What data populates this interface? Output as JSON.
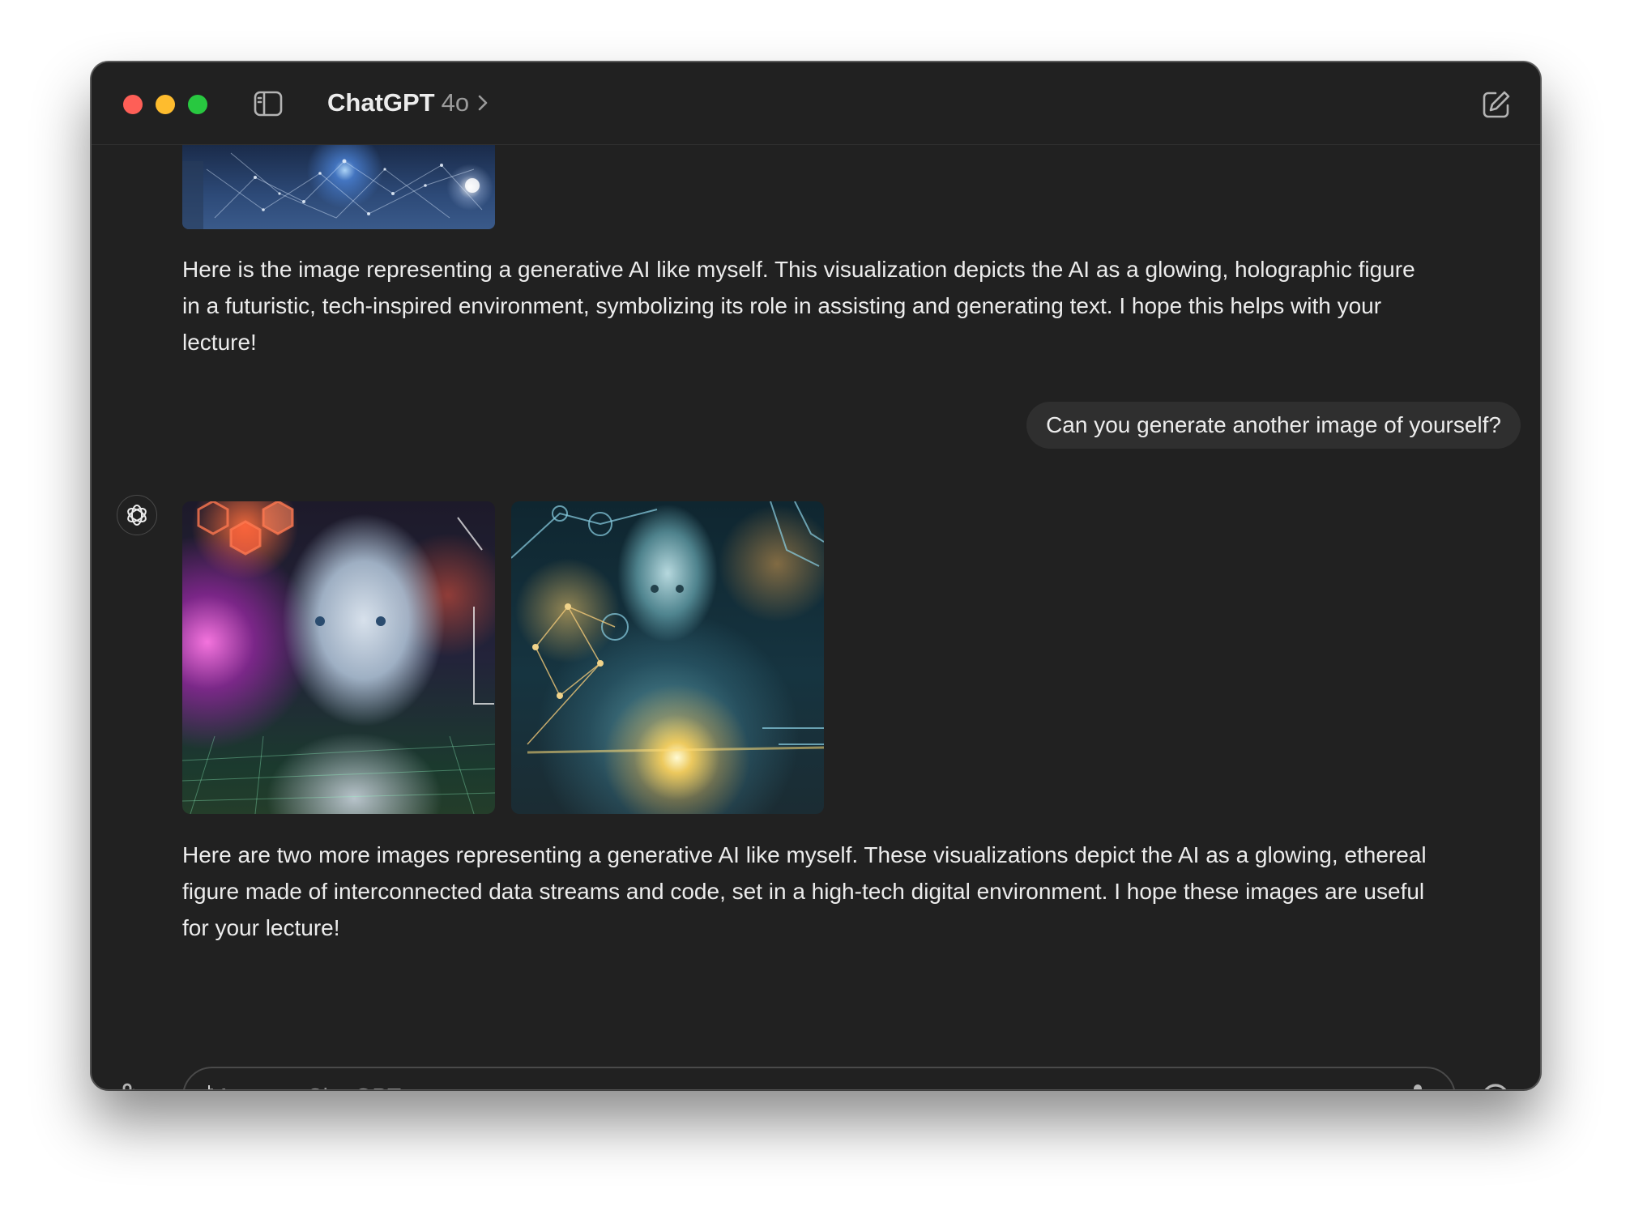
{
  "window": {
    "title": "ChatGPT",
    "model_version": "4o"
  },
  "conversation": {
    "previous_reply": "Here is the image representing a generative AI like myself. This visualization depicts the AI as a glowing, holographic figure in a futuristic, tech-inspired environment, symbolizing its role in assisting and generating text. I hope this helps with your lecture!",
    "user_message": "Can you generate another image of yourself?",
    "latest_reply": "Here are two more images representing a generative AI like myself. These visualizations depict the AI as a glowing, ethereal figure made of interconnected data streams and code, set in a high-tech digital environment. I hope these images are useful for your lecture!"
  },
  "composer": {
    "placeholder": "Message ChatGPT",
    "value": ""
  },
  "icons": {
    "sidebar_toggle": "sidebar-icon",
    "new_chat": "compose-icon",
    "attach": "paperclip-icon",
    "microphone": "microphone-icon",
    "voice_mode": "headphones-icon",
    "assistant_avatar": "openai-logo-icon",
    "model_menu": "chevron-right-icon"
  },
  "colors": {
    "window_bg": "#212121",
    "bubble_bg": "#2f2f2f",
    "text": "#ececec",
    "traffic_close": "#fe5f57",
    "traffic_minimize": "#febc2e",
    "traffic_maximize": "#28c840"
  }
}
